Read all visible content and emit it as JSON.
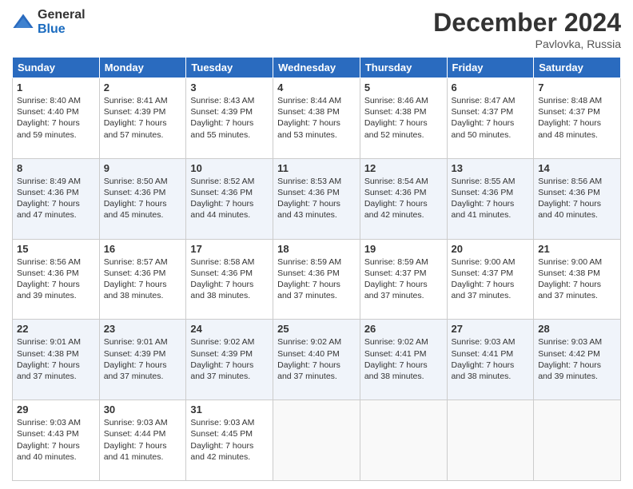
{
  "logo": {
    "general": "General",
    "blue": "Blue"
  },
  "header": {
    "title": "December 2024",
    "location": "Pavlovka, Russia"
  },
  "days": [
    "Sunday",
    "Monday",
    "Tuesday",
    "Wednesday",
    "Thursday",
    "Friday",
    "Saturday"
  ],
  "weeks": [
    [
      {
        "day": "1",
        "sunrise": "Sunrise: 8:40 AM",
        "sunset": "Sunset: 4:40 PM",
        "daylight": "Daylight: 7 hours and 59 minutes."
      },
      {
        "day": "2",
        "sunrise": "Sunrise: 8:41 AM",
        "sunset": "Sunset: 4:39 PM",
        "daylight": "Daylight: 7 hours and 57 minutes."
      },
      {
        "day": "3",
        "sunrise": "Sunrise: 8:43 AM",
        "sunset": "Sunset: 4:39 PM",
        "daylight": "Daylight: 7 hours and 55 minutes."
      },
      {
        "day": "4",
        "sunrise": "Sunrise: 8:44 AM",
        "sunset": "Sunset: 4:38 PM",
        "daylight": "Daylight: 7 hours and 53 minutes."
      },
      {
        "day": "5",
        "sunrise": "Sunrise: 8:46 AM",
        "sunset": "Sunset: 4:38 PM",
        "daylight": "Daylight: 7 hours and 52 minutes."
      },
      {
        "day": "6",
        "sunrise": "Sunrise: 8:47 AM",
        "sunset": "Sunset: 4:37 PM",
        "daylight": "Daylight: 7 hours and 50 minutes."
      },
      {
        "day": "7",
        "sunrise": "Sunrise: 8:48 AM",
        "sunset": "Sunset: 4:37 PM",
        "daylight": "Daylight: 7 hours and 48 minutes."
      }
    ],
    [
      {
        "day": "8",
        "sunrise": "Sunrise: 8:49 AM",
        "sunset": "Sunset: 4:36 PM",
        "daylight": "Daylight: 7 hours and 47 minutes."
      },
      {
        "day": "9",
        "sunrise": "Sunrise: 8:50 AM",
        "sunset": "Sunset: 4:36 PM",
        "daylight": "Daylight: 7 hours and 45 minutes."
      },
      {
        "day": "10",
        "sunrise": "Sunrise: 8:52 AM",
        "sunset": "Sunset: 4:36 PM",
        "daylight": "Daylight: 7 hours and 44 minutes."
      },
      {
        "day": "11",
        "sunrise": "Sunrise: 8:53 AM",
        "sunset": "Sunset: 4:36 PM",
        "daylight": "Daylight: 7 hours and 43 minutes."
      },
      {
        "day": "12",
        "sunrise": "Sunrise: 8:54 AM",
        "sunset": "Sunset: 4:36 PM",
        "daylight": "Daylight: 7 hours and 42 minutes."
      },
      {
        "day": "13",
        "sunrise": "Sunrise: 8:55 AM",
        "sunset": "Sunset: 4:36 PM",
        "daylight": "Daylight: 7 hours and 41 minutes."
      },
      {
        "day": "14",
        "sunrise": "Sunrise: 8:56 AM",
        "sunset": "Sunset: 4:36 PM",
        "daylight": "Daylight: 7 hours and 40 minutes."
      }
    ],
    [
      {
        "day": "15",
        "sunrise": "Sunrise: 8:56 AM",
        "sunset": "Sunset: 4:36 PM",
        "daylight": "Daylight: 7 hours and 39 minutes."
      },
      {
        "day": "16",
        "sunrise": "Sunrise: 8:57 AM",
        "sunset": "Sunset: 4:36 PM",
        "daylight": "Daylight: 7 hours and 38 minutes."
      },
      {
        "day": "17",
        "sunrise": "Sunrise: 8:58 AM",
        "sunset": "Sunset: 4:36 PM",
        "daylight": "Daylight: 7 hours and 38 minutes."
      },
      {
        "day": "18",
        "sunrise": "Sunrise: 8:59 AM",
        "sunset": "Sunset: 4:36 PM",
        "daylight": "Daylight: 7 hours and 37 minutes."
      },
      {
        "day": "19",
        "sunrise": "Sunrise: 8:59 AM",
        "sunset": "Sunset: 4:37 PM",
        "daylight": "Daylight: 7 hours and 37 minutes."
      },
      {
        "day": "20",
        "sunrise": "Sunrise: 9:00 AM",
        "sunset": "Sunset: 4:37 PM",
        "daylight": "Daylight: 7 hours and 37 minutes."
      },
      {
        "day": "21",
        "sunrise": "Sunrise: 9:00 AM",
        "sunset": "Sunset: 4:38 PM",
        "daylight": "Daylight: 7 hours and 37 minutes."
      }
    ],
    [
      {
        "day": "22",
        "sunrise": "Sunrise: 9:01 AM",
        "sunset": "Sunset: 4:38 PM",
        "daylight": "Daylight: 7 hours and 37 minutes."
      },
      {
        "day": "23",
        "sunrise": "Sunrise: 9:01 AM",
        "sunset": "Sunset: 4:39 PM",
        "daylight": "Daylight: 7 hours and 37 minutes."
      },
      {
        "day": "24",
        "sunrise": "Sunrise: 9:02 AM",
        "sunset": "Sunset: 4:39 PM",
        "daylight": "Daylight: 7 hours and 37 minutes."
      },
      {
        "day": "25",
        "sunrise": "Sunrise: 9:02 AM",
        "sunset": "Sunset: 4:40 PM",
        "daylight": "Daylight: 7 hours and 37 minutes."
      },
      {
        "day": "26",
        "sunrise": "Sunrise: 9:02 AM",
        "sunset": "Sunset: 4:41 PM",
        "daylight": "Daylight: 7 hours and 38 minutes."
      },
      {
        "day": "27",
        "sunrise": "Sunrise: 9:03 AM",
        "sunset": "Sunset: 4:41 PM",
        "daylight": "Daylight: 7 hours and 38 minutes."
      },
      {
        "day": "28",
        "sunrise": "Sunrise: 9:03 AM",
        "sunset": "Sunset: 4:42 PM",
        "daylight": "Daylight: 7 hours and 39 minutes."
      }
    ],
    [
      {
        "day": "29",
        "sunrise": "Sunrise: 9:03 AM",
        "sunset": "Sunset: 4:43 PM",
        "daylight": "Daylight: 7 hours and 40 minutes."
      },
      {
        "day": "30",
        "sunrise": "Sunrise: 9:03 AM",
        "sunset": "Sunset: 4:44 PM",
        "daylight": "Daylight: 7 hours and 41 minutes."
      },
      {
        "day": "31",
        "sunrise": "Sunrise: 9:03 AM",
        "sunset": "Sunset: 4:45 PM",
        "daylight": "Daylight: 7 hours and 42 minutes."
      },
      null,
      null,
      null,
      null
    ]
  ]
}
